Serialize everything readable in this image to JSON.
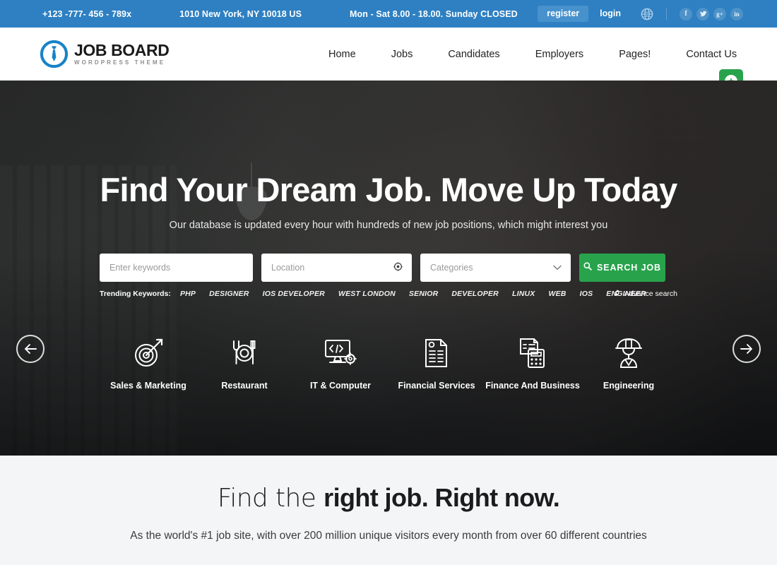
{
  "topbar": {
    "phone": "+123 -777- 456 - 789x",
    "address": "1010 New York, NY 10018 US",
    "hours": "Mon - Sat 8.00 - 18.00. Sunday CLOSED",
    "register_label": "register",
    "login_label": "login",
    "globe_icon": "globe-icon",
    "socials": [
      {
        "name": "facebook-icon",
        "glyph": "f"
      },
      {
        "name": "twitter-icon",
        "glyph": "t"
      },
      {
        "name": "google-plus-icon",
        "glyph": "g+"
      },
      {
        "name": "linkedin-icon",
        "glyph": "in"
      }
    ],
    "bg_color": "#2e80c2"
  },
  "header": {
    "logo_title": "JOB BOARD",
    "logo_sub": "WORDPRESS THEME",
    "logo_icon": "tie-circle-logo-icon",
    "nav": [
      {
        "label": "Home"
      },
      {
        "label": "Jobs"
      },
      {
        "label": "Candidates"
      },
      {
        "label": "Employers"
      },
      {
        "label": "Pages!"
      },
      {
        "label": "Contact Us"
      }
    ],
    "plus_button": {
      "name": "add-post-button",
      "glyph": "+",
      "color": "#28a34c"
    }
  },
  "hero": {
    "title": "Find Your Dream Job. Move Up Today",
    "subtitle": "Our database is updated every hour with hundreds of new job positions, which might interest you",
    "prev_arrow": "arrow-left-icon",
    "next_arrow": "arrow-right-icon",
    "search": {
      "keywords_placeholder": "Enter keywords",
      "keywords_value": "",
      "location_placeholder": "Location",
      "location_value": "",
      "location_icon": "crosshair-locate-icon",
      "categories_placeholder": "Categories",
      "categories_value": "",
      "categories_options": [
        "Categories"
      ],
      "dropdown_icon": "chevron-down-icon",
      "button_label": "SEARCH JOB",
      "button_icon": "search-icon",
      "button_color": "#28a34c"
    },
    "trending": {
      "label": "Trending Keywords:",
      "tags": [
        "PHP",
        "DESIGNER",
        "IOS DEVELOPER",
        "WEST LONDON",
        "SENIOR",
        "DEVELOPER",
        "LINUX",
        "WEB",
        "IOS",
        "ENGINEER"
      ],
      "advance_label": "Advance search",
      "advance_icon": "gear-icon"
    },
    "categories": [
      {
        "label": "Sales & Marketing",
        "icon": "target-arrow-icon"
      },
      {
        "label": "Restaurant",
        "icon": "plate-cutlery-icon"
      },
      {
        "label": "IT & Computer",
        "icon": "monitor-code-gear-icon"
      },
      {
        "label": "Financial Services",
        "icon": "invoice-document-icon"
      },
      {
        "label": "Finance And Business",
        "icon": "invoice-calculator-icon"
      },
      {
        "label": "Engineering",
        "icon": "hardhat-worker-icon"
      }
    ]
  },
  "lower": {
    "title_thin": "Find the ",
    "title_bold": "right job. Right now.",
    "subtitle": "As the world's #1 job site, with over 200 million unique visitors every month from over 60 different countries",
    "bg_color": "#f4f5f7"
  }
}
